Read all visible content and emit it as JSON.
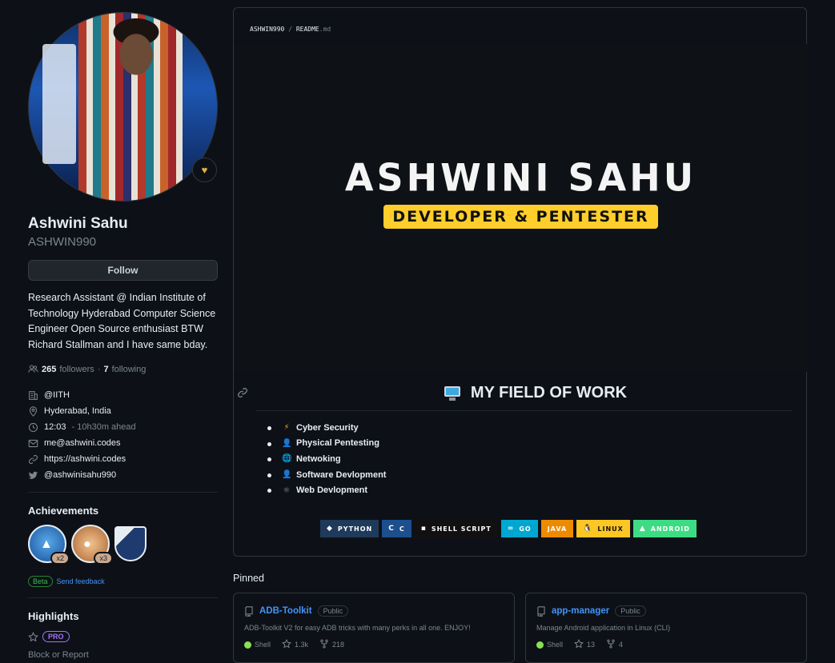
{
  "profile": {
    "name": "Ashwini Sahu",
    "username": "ASHWIN990",
    "follow_label": "Follow",
    "bio": "Research Assistant @ Indian Institute of Technology Hyderabad Computer Science Engineer Open Source enthusiast BTW Richard Stallman and I have same bday.",
    "followers_count": "265",
    "followers_label": "followers",
    "dot": "·",
    "following_count": "7",
    "following_label": "following",
    "details": {
      "org": "@IITH",
      "location": "Hyderabad, India",
      "time": "12:03",
      "time_offset": "- 10h30m ahead",
      "email": "me@ashwini.codes",
      "website": "https://ashwini.codes",
      "twitter": "@ashwinisahu990"
    },
    "emoji_status": "heart"
  },
  "achievements": {
    "title": "Achievements",
    "items": [
      {
        "name": "shark",
        "count": "x2"
      },
      {
        "name": "pair",
        "count": "x3"
      },
      {
        "name": "yolo",
        "count": ""
      }
    ],
    "beta": "Beta",
    "feedback": "Send feedback"
  },
  "highlights": {
    "title": "Highlights",
    "pro": "PRO",
    "block_report": "Block or Report"
  },
  "readme": {
    "path_user": "ASHWIN990",
    "path_sep": "/",
    "path_file": "README",
    "path_ext": ".md",
    "banner_title": "ASHWINI SAHU",
    "banner_subtitle": "DEVELOPER & PENTESTER",
    "field_heading": "MY FIELD OF WORK",
    "fields": [
      {
        "emoji": "⚡",
        "label": "Cyber Security"
      },
      {
        "emoji": "👤",
        "label": "Physical Pentesting"
      },
      {
        "emoji": "🌐",
        "label": "Netwoking"
      },
      {
        "emoji": "👤",
        "label": "Software Devlopment"
      },
      {
        "emoji": "⚛",
        "label": "Web Devlopment"
      }
    ],
    "badges": [
      {
        "label": "PYTHON",
        "icon": "python-icon",
        "glyph": "◆",
        "color": "#1f3a5a"
      },
      {
        "label": "C",
        "icon": "c-icon",
        "glyph": "C",
        "color": "#1c4f8c"
      },
      {
        "label": "SHELL SCRIPT",
        "icon": "shell-icon",
        "glyph": "▪",
        "color": "#121011"
      },
      {
        "label": "GO",
        "icon": "go-icon",
        "glyph": "∞",
        "color": "#00a7d0"
      },
      {
        "label": "JAVA",
        "icon": "java-icon",
        "glyph": "",
        "color": "#ed8b00"
      },
      {
        "label": "LINUX",
        "icon": "linux-icon",
        "glyph": "🐧",
        "color": "#fcc624"
      },
      {
        "label": "ANDROID",
        "icon": "android-icon",
        "glyph": "▲",
        "color": "#3ddc84"
      }
    ]
  },
  "pinned": {
    "title": "Pinned",
    "repos": [
      {
        "name": "ADB-Toolkit",
        "visibility": "Public",
        "description": "ADB-Toolkit V2 for easy ADB tricks with many perks in all one. ENJOY!",
        "language": "Shell",
        "stars": "1.3k",
        "forks": "218"
      },
      {
        "name": "app-manager",
        "visibility": "Public",
        "description": "Manage Android application in Linux (CLI)",
        "language": "Shell",
        "stars": "13",
        "forks": "4"
      }
    ]
  }
}
